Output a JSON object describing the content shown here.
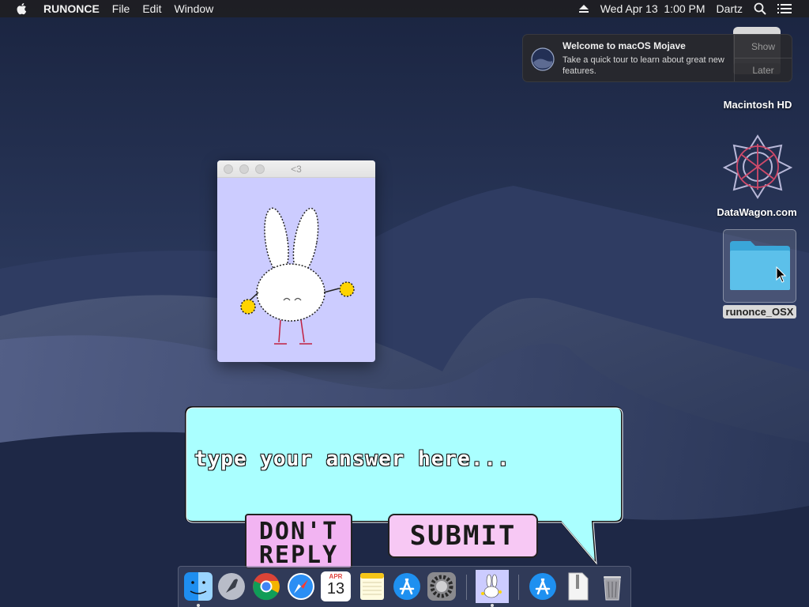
{
  "menubar": {
    "app_name": "RUNONCE",
    "menus": [
      "File",
      "Edit",
      "Window"
    ],
    "datetime": "Wed Apr 13  1:00 PM",
    "user": "Dartz"
  },
  "notification": {
    "title": "Welcome to macOS Mojave",
    "body": "Take a quick tour to learn about great new features.",
    "show_label": "Show",
    "later_label": "Later"
  },
  "desktop": {
    "icons": [
      {
        "label": "Macintosh HD"
      },
      {
        "label": "DataWagon.com"
      },
      {
        "label": "runonce_OSX"
      }
    ]
  },
  "window": {
    "title": "<3"
  },
  "answer": {
    "placeholder": "type your answer here...",
    "value": ""
  },
  "buttons": {
    "dont_reply": "DON'T REPLY",
    "submit": "SUBMIT"
  },
  "dock": {
    "calendar_month": "APR",
    "calendar_day": "13",
    "items": [
      {
        "name": "finder-icon"
      },
      {
        "name": "launchpad-icon"
      },
      {
        "name": "chrome-icon"
      },
      {
        "name": "safari-icon"
      },
      {
        "name": "calendar-icon"
      },
      {
        "name": "notes-icon"
      },
      {
        "name": "app-store-icon"
      },
      {
        "name": "system-preferences-icon"
      },
      {
        "name": "runonce-app-icon"
      },
      {
        "name": "app-store-downloads-icon"
      },
      {
        "name": "zip-file-icon"
      },
      {
        "name": "trash-icon"
      }
    ]
  },
  "colors": {
    "window_bg": "#ccccff",
    "bubble_bg": "#aaffff",
    "dont_reply_bg": "#f2b4f2",
    "submit_bg": "#f7c8f4"
  }
}
